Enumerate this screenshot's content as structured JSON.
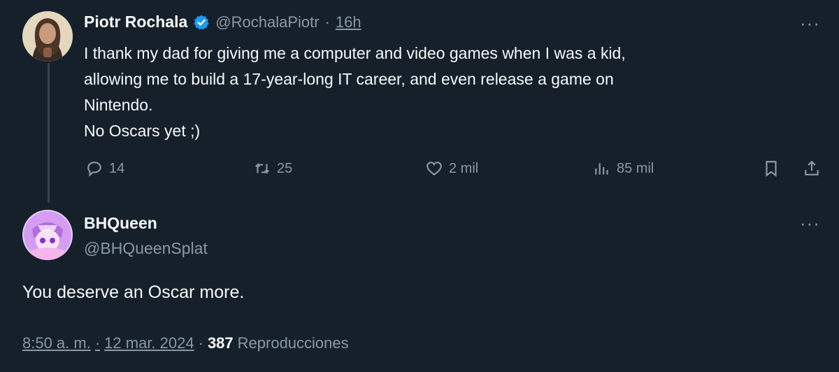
{
  "parent_tweet": {
    "author_name": "Piotr Rochala",
    "handle": "@RochalaPiotr",
    "separator": "·",
    "time": "16h",
    "text": "I thank my dad for giving me a computer and video games when I was a kid,\nallowing me to build a 17-year-long IT career, and even release a game on\nNintendo.\nNo Oscars yet ;)",
    "actions": {
      "replies": "14",
      "retweets": "25",
      "likes": "2 mil",
      "views": "85 mil"
    },
    "more_label": "···"
  },
  "reply_tweet": {
    "author_name": "BHQueen",
    "handle": "@BHQueenSplat",
    "text": "You deserve an Oscar more.",
    "more_label": "···",
    "meta": {
      "time": "8:50 a. m.",
      "dot": "·",
      "date": "12 mar. 2024",
      "dot2": "·",
      "views_count": "387",
      "views_label": "Reproducciones"
    }
  },
  "colors": {
    "background": "#15202b",
    "text": "#f7f9f9",
    "muted": "#8b98a5",
    "verified": "#1d9bf0"
  }
}
